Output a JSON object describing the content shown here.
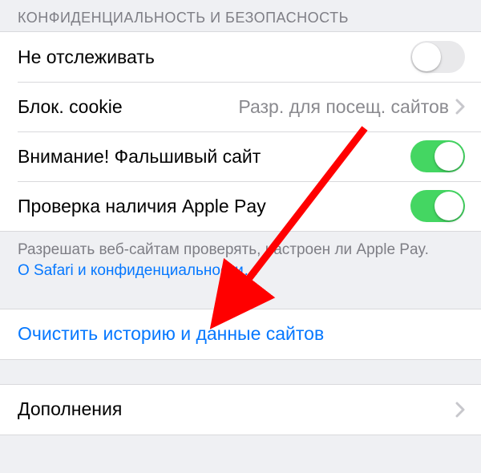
{
  "section_header": "КОНФИДЕНЦИАЛЬНОСТЬ И БЕЗОПАСНОСТЬ",
  "rows": {
    "do_not_track": {
      "label": "Не отслеживать",
      "on": false
    },
    "block_cookie": {
      "label": "Блок. cookie",
      "value": "Разр. для посещ. сайтов"
    },
    "fraud_warning": {
      "label": "Внимание! Фальшивый сайт",
      "on": true
    },
    "apple_pay_check": {
      "label": "Проверка наличия Apple Pay",
      "on": true
    }
  },
  "footer": {
    "note": "Разрешать веб-сайтам проверять, настроен ли Apple Pay.",
    "link": "О Safari и конфиденциальности…"
  },
  "clear_history": {
    "label": "Очистить историю и данные сайтов"
  },
  "addons": {
    "label": "Дополнения"
  }
}
